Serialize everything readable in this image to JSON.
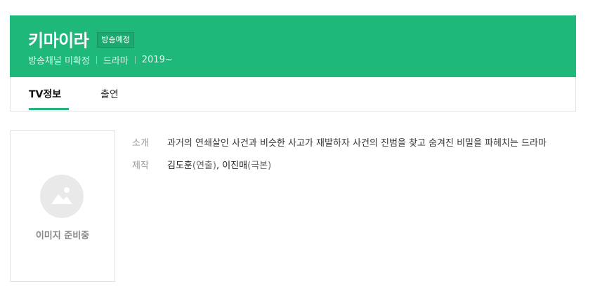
{
  "header": {
    "title": "키마이라",
    "badge": "방송예정",
    "channel": "방송채널 미확정",
    "genre": "드라마",
    "year": "2019~",
    "background_color": "#1eb87a"
  },
  "tabs": [
    {
      "label": "TV정보",
      "active": true
    },
    {
      "label": "출연",
      "active": false
    }
  ],
  "poster": {
    "placeholder_text": "이미지 준비중",
    "icon": "image-icon"
  },
  "info": {
    "summary_label": "소개",
    "summary_text": "과거의 연쇄살인 사건과 비슷한 사고가 재발하자 사건의 진범을 찾고 숨겨진 비밀을 파헤치는 드라마",
    "production_label": "제작",
    "producers": [
      {
        "name": "김도훈",
        "role": "(연출)"
      },
      {
        "name": "이진매",
        "role": "(극본)"
      }
    ],
    "separator": ", "
  }
}
